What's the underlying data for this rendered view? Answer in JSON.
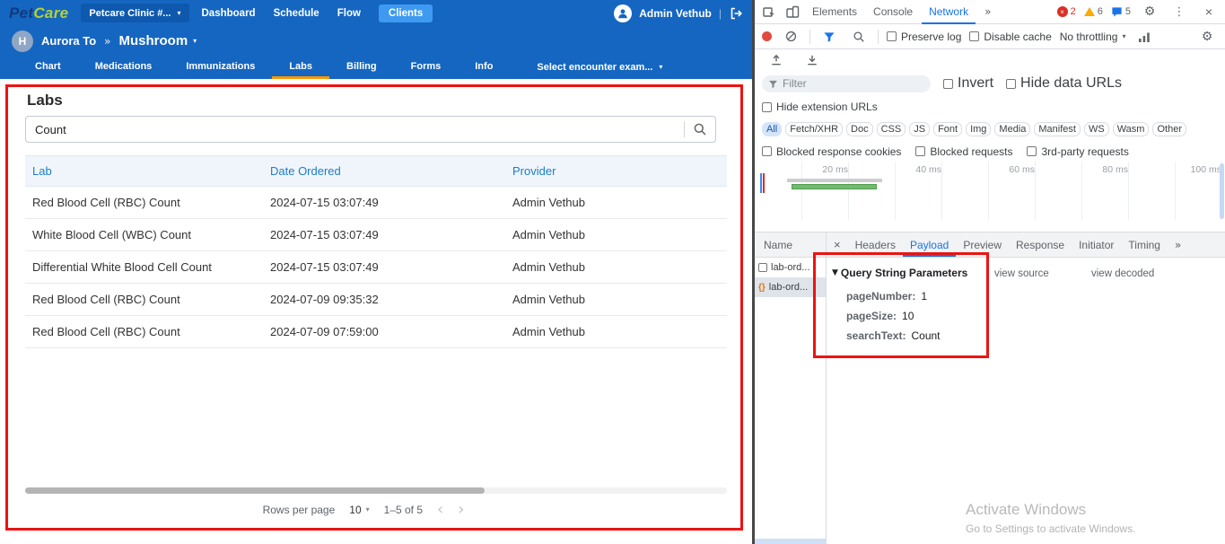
{
  "icons": {
    "caret_down": "▾",
    "triangle_down": "▼",
    "breadcrumb_sep": "»",
    "more": "»",
    "chevron_left": "‹",
    "chevron_right": "›",
    "overflow": "⋮",
    "close": "×",
    "gear": "⚙",
    "pipe": "|",
    "braces": "{}"
  },
  "app": {
    "brand": {
      "pet": "Pet",
      "care": "Care"
    },
    "clinic_button": "Petcare Clinic #...",
    "nav": [
      "Dashboard",
      "Schedule",
      "Flow",
      "Clients"
    ],
    "user_name": "Admin Vethub",
    "patient": {
      "avatar_letter": "H",
      "owner": "Aurora To",
      "name": "Mushroom"
    },
    "tabs": [
      "Chart",
      "Medications",
      "Immunizations",
      "Labs",
      "Billing",
      "Forms",
      "Info"
    ],
    "encounter_select": "Select encounter exam...",
    "labs": {
      "title": "Labs",
      "search_value": "Count",
      "table": {
        "headers": [
          "Lab",
          "Date Ordered",
          "Provider"
        ],
        "rows": [
          [
            "Red Blood Cell (RBC) Count",
            "2024-07-15 03:07:49",
            "Admin Vethub"
          ],
          [
            "White Blood Cell (WBC) Count",
            "2024-07-15 03:07:49",
            "Admin Vethub"
          ],
          [
            "Differential White Blood Cell Count",
            "2024-07-15 03:07:49",
            "Admin Vethub"
          ],
          [
            "Red Blood Cell (RBC) Count",
            "2024-07-09 09:35:32",
            "Admin Vethub"
          ],
          [
            "Red Blood Cell (RBC) Count",
            "2024-07-09 07:59:00",
            "Admin Vethub"
          ]
        ]
      },
      "pagination": {
        "rows_per_page_label": "Rows per page",
        "rows_per_page_value": "10",
        "range": "1–5 of 5"
      }
    }
  },
  "devtools": {
    "main_tabs": [
      "Elements",
      "Console",
      "Network"
    ],
    "badges": {
      "errors": "2",
      "warnings": "6",
      "issues": "5"
    },
    "toolbar": {
      "preserve_log": "Preserve log",
      "disable_cache": "Disable cache",
      "throttling": "No throttling"
    },
    "filter": {
      "placeholder": "Filter",
      "invert": "Invert",
      "hide_data_urls": "Hide data URLs",
      "hide_extension_urls": "Hide extension URLs"
    },
    "chips": [
      "All",
      "Fetch/XHR",
      "Doc",
      "CSS",
      "JS",
      "Font",
      "Img",
      "Media",
      "Manifest",
      "WS",
      "Wasm",
      "Other"
    ],
    "blocked": {
      "cookies": "Blocked response cookies",
      "requests": "Blocked requests",
      "third_party": "3rd-party requests"
    },
    "timeline_ticks": [
      "20 ms",
      "40 ms",
      "60 ms",
      "80 ms",
      "100 ms"
    ],
    "requests": {
      "name_header": "Name",
      "items": [
        "lab-ord...",
        "lab-ord..."
      ]
    },
    "detail_tabs": [
      "Headers",
      "Payload",
      "Preview",
      "Response",
      "Initiator",
      "Timing"
    ],
    "payload": {
      "section_title": "Query String Parameters",
      "view_source": "view source",
      "view_decoded": "view decoded",
      "params": [
        {
          "name": "pageNumber:",
          "value": "1"
        },
        {
          "name": "pageSize:",
          "value": "10"
        },
        {
          "name": "searchText:",
          "value": "Count"
        }
      ]
    },
    "watermark": {
      "title": "Activate Windows",
      "subtitle": "Go to Settings to activate Windows."
    }
  }
}
